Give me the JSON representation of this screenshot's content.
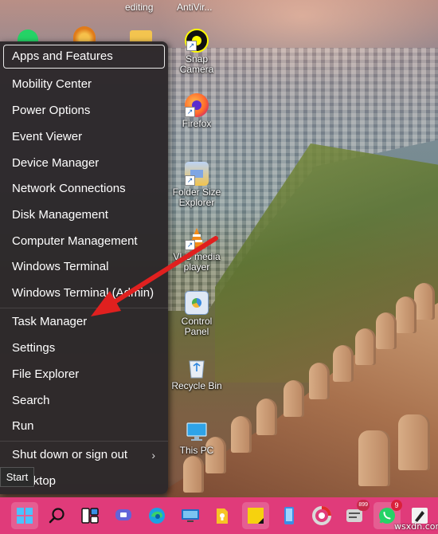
{
  "desktop": {
    "top_labels": [
      "editing",
      "AntiVir..."
    ],
    "icons": [
      {
        "label": "Snap Camera",
        "icon": "snap-camera-icon"
      },
      {
        "label": "Firefox",
        "icon": "firefox-icon"
      },
      {
        "label": "Folder Size Explorer",
        "icon": "folder-size-explorer-icon"
      },
      {
        "label": "VLC media player",
        "icon": "vlc-icon"
      },
      {
        "label": "Control Panel",
        "icon": "control-panel-icon"
      },
      {
        "label": "Recycle Bin",
        "icon": "recycle-bin-icon"
      },
      {
        "label": "This PC",
        "icon": "this-pc-icon"
      }
    ]
  },
  "winx_menu": {
    "items": [
      {
        "label": "Apps and Features",
        "focused": true
      },
      {
        "label": "Mobility Center"
      },
      {
        "label": "Power Options"
      },
      {
        "label": "Event Viewer"
      },
      {
        "label": "Device Manager"
      },
      {
        "label": "Network Connections"
      },
      {
        "label": "Disk Management"
      },
      {
        "label": "Computer Management"
      },
      {
        "label": "Windows Terminal"
      },
      {
        "label": "Windows Terminal (Admin)"
      },
      {
        "label": "Task Manager"
      },
      {
        "label": "Settings"
      },
      {
        "label": "File Explorer"
      },
      {
        "label": "Search"
      },
      {
        "label": "Run"
      },
      {
        "label": "Shut down or sign out",
        "submenu": true
      },
      {
        "label": "Desktop"
      }
    ],
    "chevron": "›"
  },
  "tooltip": {
    "start": "Start"
  },
  "annotation": {
    "arrow_color": "#e0201f",
    "points_to": "Task Manager"
  },
  "taskbar": {
    "color": "#e03b7a",
    "items": [
      {
        "name": "start",
        "icon": "windows-logo-icon"
      },
      {
        "name": "search",
        "icon": "search-icon"
      },
      {
        "name": "task-view",
        "icon": "task-view-icon"
      },
      {
        "name": "teams-chat",
        "icon": "teams-chat-icon"
      },
      {
        "name": "edge",
        "icon": "edge-icon"
      },
      {
        "name": "remote-desktop",
        "icon": "remote-desktop-icon"
      },
      {
        "name": "keep",
        "icon": "keep-icon"
      },
      {
        "name": "sticky-notes",
        "icon": "sticky-notes-icon"
      },
      {
        "name": "phone-link",
        "icon": "phone-icon"
      },
      {
        "name": "chrome-like",
        "icon": "circle-app-icon"
      },
      {
        "name": "app-899",
        "icon": "app-icon",
        "badge": "899"
      },
      {
        "name": "whatsapp",
        "icon": "whatsapp-icon",
        "badge": "9"
      },
      {
        "name": "pen-app",
        "icon": "pen-icon"
      }
    ]
  },
  "watermark": "wsxdn.com"
}
